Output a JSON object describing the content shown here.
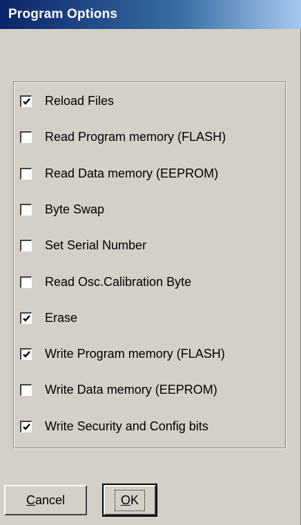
{
  "window": {
    "title": "Program Options"
  },
  "options": [
    {
      "label": "Reload Files",
      "checked": true
    },
    {
      "label": "Read Program memory (FLASH)",
      "checked": false
    },
    {
      "label": "Read Data memory (EEPROM)",
      "checked": false
    },
    {
      "label": "Byte Swap",
      "checked": false
    },
    {
      "label": "Set Serial Number",
      "checked": false
    },
    {
      "label": "Read Osc.Calibration Byte",
      "checked": false
    },
    {
      "label": "Erase",
      "checked": true
    },
    {
      "label": "Write Program memory (FLASH)",
      "checked": true
    },
    {
      "label": "Write Data memory (EEPROM)",
      "checked": false
    },
    {
      "label": "Write Security and Config bits",
      "checked": true
    }
  ],
  "buttons": {
    "cancel_accel": "C",
    "cancel_rest": "ancel",
    "ok_accel": "O",
    "ok_rest": "K"
  },
  "colors": {
    "face": "#d4d0c8",
    "title_start": "#0a246a",
    "title_end": "#a6caf0"
  }
}
